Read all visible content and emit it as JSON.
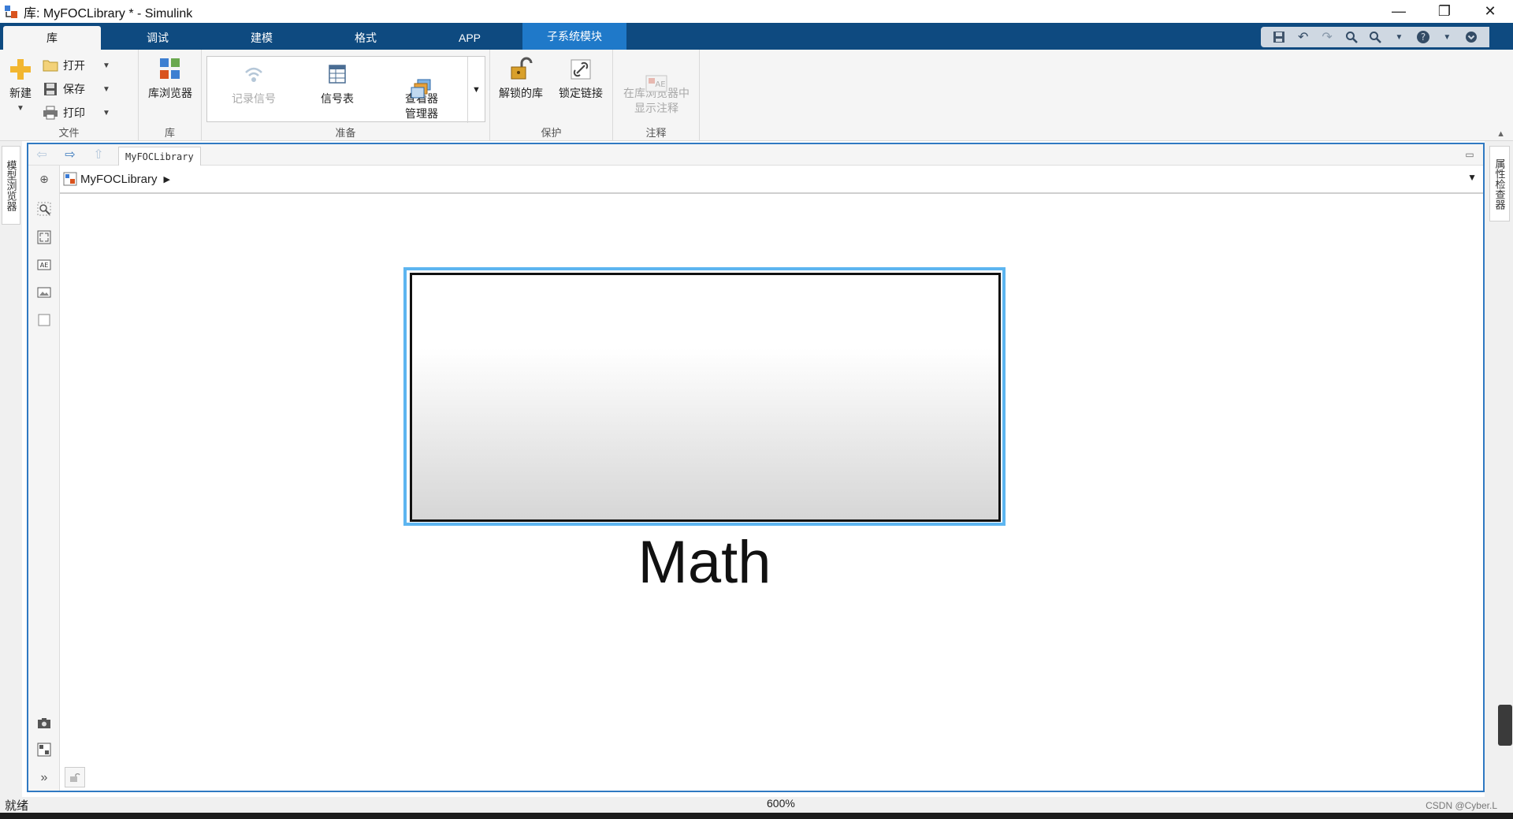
{
  "window": {
    "title": "库: MyFOCLibrary * - Simulink",
    "minimize": "—",
    "restore": "❐",
    "close": "✕"
  },
  "tabs": [
    {
      "label": "库",
      "active": true
    },
    {
      "label": "调试"
    },
    {
      "label": "建模"
    },
    {
      "label": "格式"
    },
    {
      "label": "APP"
    },
    {
      "label": "子系统模块",
      "contextual": true
    }
  ],
  "ribbon": {
    "file": {
      "group_label": "文件",
      "new_label": "新建",
      "open_label": "打开",
      "save_label": "保存",
      "print_label": "打印"
    },
    "library": {
      "group_label": "库",
      "browser_label": "库浏览器"
    },
    "prepare": {
      "group_label": "准备",
      "log_signals_label": "记录信号",
      "signal_table_label": "信号表",
      "viewer_manager_label": "查看器\n管理器"
    },
    "protect": {
      "group_label": "保护",
      "unlock_label": "解锁的库",
      "lock_links_label": "锁定链接"
    },
    "annotate": {
      "group_label": "注释",
      "show_annotation_label": "在库浏览器中\n显示注释"
    }
  },
  "side_panels": {
    "left_label": "模型浏览器",
    "right_label": "属性检查器"
  },
  "editor": {
    "breadcrumb_tab": "MyFOCLibrary",
    "address": "MyFOCLibrary",
    "block_label": "Math"
  },
  "status": {
    "left": "就绪",
    "zoom": "600%",
    "credit": "CSDN @Cyber.L"
  },
  "colors": {
    "tabbar": "#0e4a80",
    "contextual_tab": "#1f79c9",
    "editor_border": "#2f79c2",
    "selection": "#5db5f0"
  }
}
